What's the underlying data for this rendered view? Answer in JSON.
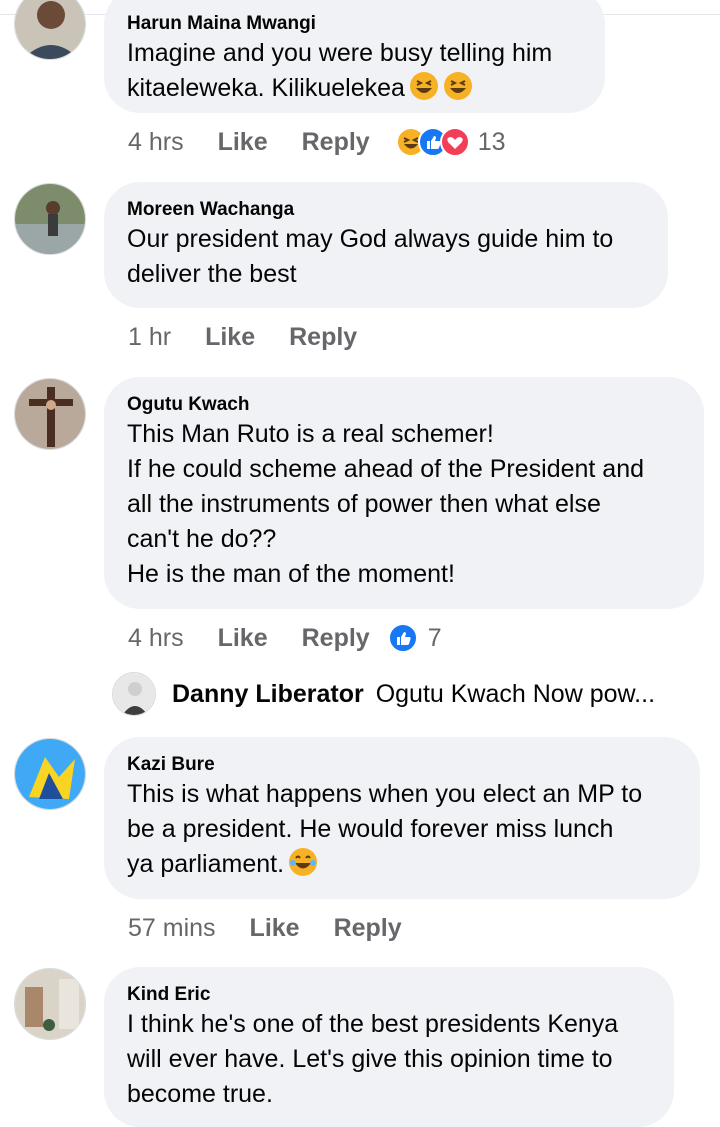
{
  "comments": [
    {
      "author": "Harun Maina Mwangi",
      "text": "Imagine and you were busy telling him\nkitaeleweka. Kilikuelekea",
      "time": "4 hrs",
      "like_label": "Like",
      "reply_label": "Reply",
      "reaction_count": "13",
      "reactions": [
        "laugh",
        "like",
        "love"
      ]
    },
    {
      "author": "Moreen Wachanga",
      "text": "Our president may God always guide him to\ndeliver the best",
      "time": "1 hr",
      "like_label": "Like",
      "reply_label": "Reply"
    },
    {
      "author": "Ogutu Kwach",
      "text": "This Man Ruto is a real schemer!\nIf he could scheme ahead of the President and\nall the instruments of power then what else\ncan't he do??\nHe is the man of the moment!",
      "time": "4 hrs",
      "like_label": "Like",
      "reply_label": "Reply",
      "reaction_count": "7",
      "reactions": [
        "like"
      ]
    },
    {
      "author": "Kazi Bure",
      "text": "This is what happens when you elect an MP to\nbe a president. He would forever miss lunch\nya parliament.",
      "time": "57 mins",
      "like_label": "Like",
      "reply_label": "Reply"
    },
    {
      "author": "Kind Eric",
      "text": "I think he's one of the best presidents Kenya\nwill ever have. Let's give this opinion time to\nbecome true."
    }
  ],
  "reply_preview": {
    "author": "Danny Liberator",
    "text": "Ogutu Kwach Now pow..."
  },
  "colors": {
    "like_blue": "#1877f2",
    "love_red": "#f33e58",
    "haha_yellow": "#f7b125",
    "bubble_bg": "#f0f2f5",
    "meta_gray": "#65676b"
  }
}
